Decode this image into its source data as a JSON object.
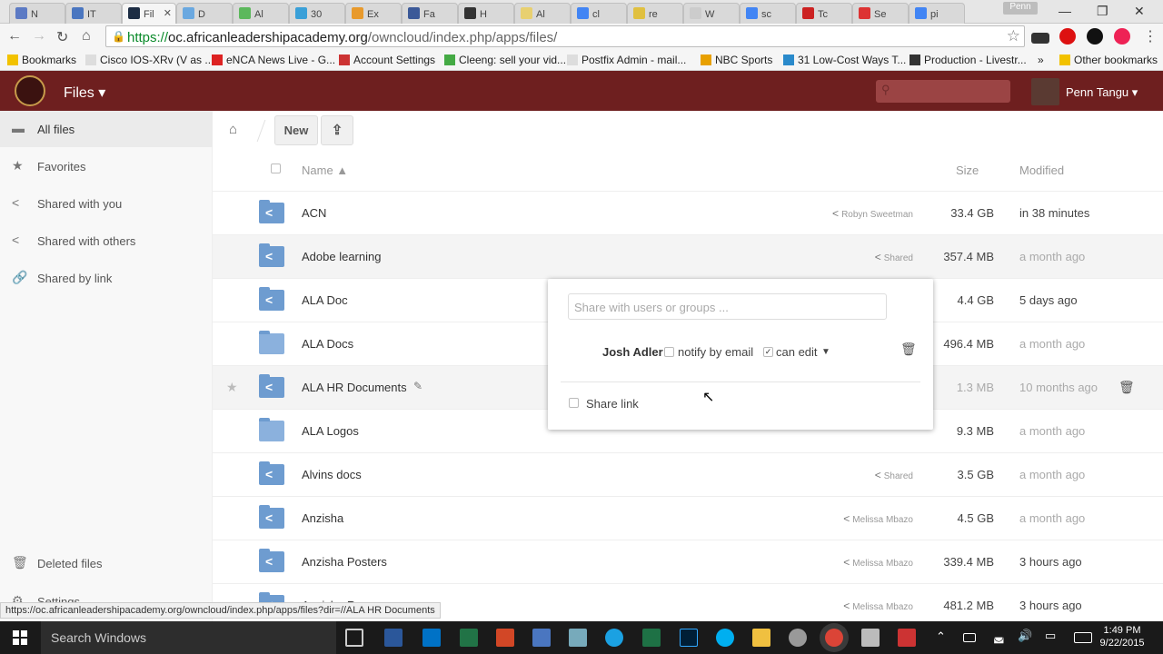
{
  "browser": {
    "tabs": [
      {
        "label": "N",
        "color": "#5c7ac4"
      },
      {
        "label": "IT",
        "color": "#4a76c0"
      },
      {
        "label": "Fil",
        "color": "#1d2d44",
        "active": true
      },
      {
        "label": "D",
        "color": "#6aa8e0"
      },
      {
        "label": "Al",
        "color": "#5cb85c"
      },
      {
        "label": "30",
        "color": "#3aa0d8"
      },
      {
        "label": "Ex",
        "color": "#e89a2c"
      },
      {
        "label": "Fa",
        "color": "#3b5998"
      },
      {
        "label": "H",
        "color": "#333333"
      },
      {
        "label": "Al",
        "color": "#e8d070"
      },
      {
        "label": "cl",
        "color": "#4285f4"
      },
      {
        "label": "re",
        "color": "#e0c040"
      },
      {
        "label": "W",
        "color": "#cccccc"
      },
      {
        "label": "sc",
        "color": "#4285f4"
      },
      {
        "label": "Tc",
        "color": "#cc2222"
      },
      {
        "label": "Se",
        "color": "#d33"
      },
      {
        "label": "pi",
        "color": "#4285f4"
      }
    ],
    "profile": "Penn",
    "url_secure": "https://",
    "url_host": "oc.africanleadershipacademy.org",
    "url_path": "/owncloud/index.php/apps/files/",
    "bookmarks": [
      {
        "label": "Bookmarks",
        "color": "#f2c200"
      },
      {
        "label": "Cisco IOS-XRv (V as ...",
        "color": "#dddddd"
      },
      {
        "label": "eNCA News Live - G...",
        "color": "#d22"
      },
      {
        "label": "Account Settings",
        "color": "#c33"
      },
      {
        "label": "Cleeng: sell your vid...",
        "color": "#4a4"
      },
      {
        "label": "Postfix Admin - mail...",
        "color": "#dddddd"
      },
      {
        "label": "NBC Sports",
        "color": "#e8a000"
      },
      {
        "label": "31 Low-Cost Ways T...",
        "color": "#2a8acb"
      },
      {
        "label": "Production - Livestr...",
        "color": "#333"
      },
      {
        "label": "»",
        "color": ""
      },
      {
        "label": "Other bookmarks",
        "color": "#f2c200"
      }
    ]
  },
  "app": {
    "name": "Files ▾",
    "user": "Penn Tangu ▾",
    "search_placeholder": ""
  },
  "sidebar": {
    "items": [
      {
        "label": "All files",
        "icon": "folder-icon"
      },
      {
        "label": "Favorites",
        "icon": "star-icon"
      },
      {
        "label": "Shared with you",
        "icon": "share-icon"
      },
      {
        "label": "Shared with others",
        "icon": "share-icon"
      },
      {
        "label": "Shared by link",
        "icon": "link-icon"
      }
    ],
    "deleted": "Deleted files",
    "settings": "Settings"
  },
  "controls": {
    "new_label": "New"
  },
  "table": {
    "col_name": "Name ▲",
    "col_size": "Size",
    "col_modified": "Modified",
    "rows": [
      {
        "name": "ACN",
        "share": "Robyn Sweetman",
        "size": "33.4 GB",
        "modified": "in 38 minutes",
        "shared": true
      },
      {
        "name": "Adobe learning",
        "share": "Shared",
        "size": "357.4 MB",
        "modified": "a month ago",
        "shared": true
      },
      {
        "name": "ALA Doc",
        "share": "",
        "size": "4.4 GB",
        "modified": "5 days ago",
        "shared": true
      },
      {
        "name": "ALA Docs",
        "share": "",
        "size": "496.4 MB",
        "modified": "a month ago",
        "shared": false
      },
      {
        "name": "ALA HR Documents",
        "share": "",
        "size": "1.3 MB",
        "modified": "10 months ago",
        "shared": true
      },
      {
        "name": "ALA Logos",
        "share": "",
        "size": "9.3 MB",
        "modified": "a month ago",
        "shared": false
      },
      {
        "name": "Alvins docs",
        "share": "Shared",
        "size": "3.5 GB",
        "modified": "a month ago",
        "shared": true
      },
      {
        "name": "Anzisha",
        "share": "Melissa Mbazo",
        "size": "4.5 GB",
        "modified": "a month ago",
        "shared": true
      },
      {
        "name": "Anzisha Posters",
        "share": "Melissa Mbazo",
        "size": "339.4 MB",
        "modified": "3 hours ago",
        "shared": true
      },
      {
        "name": "Anzisha Re...",
        "share": "Melissa Mbazo",
        "size": "481.2 MB",
        "modified": "3 hours ago",
        "shared": true
      }
    ]
  },
  "share_popup": {
    "placeholder": "Share with users or groups ...",
    "user": "Josh Adler",
    "notify": "notify by email",
    "can_edit": "can edit",
    "caret": "▼",
    "share_link": "Share link"
  },
  "status_url": "https://oc.africanleadershipacademy.org/owncloud/index.php/apps/files?dir=//ALA HR Documents",
  "taskbar": {
    "search": "Search Windows",
    "time": "1:49 PM",
    "date": "9/22/2015"
  }
}
